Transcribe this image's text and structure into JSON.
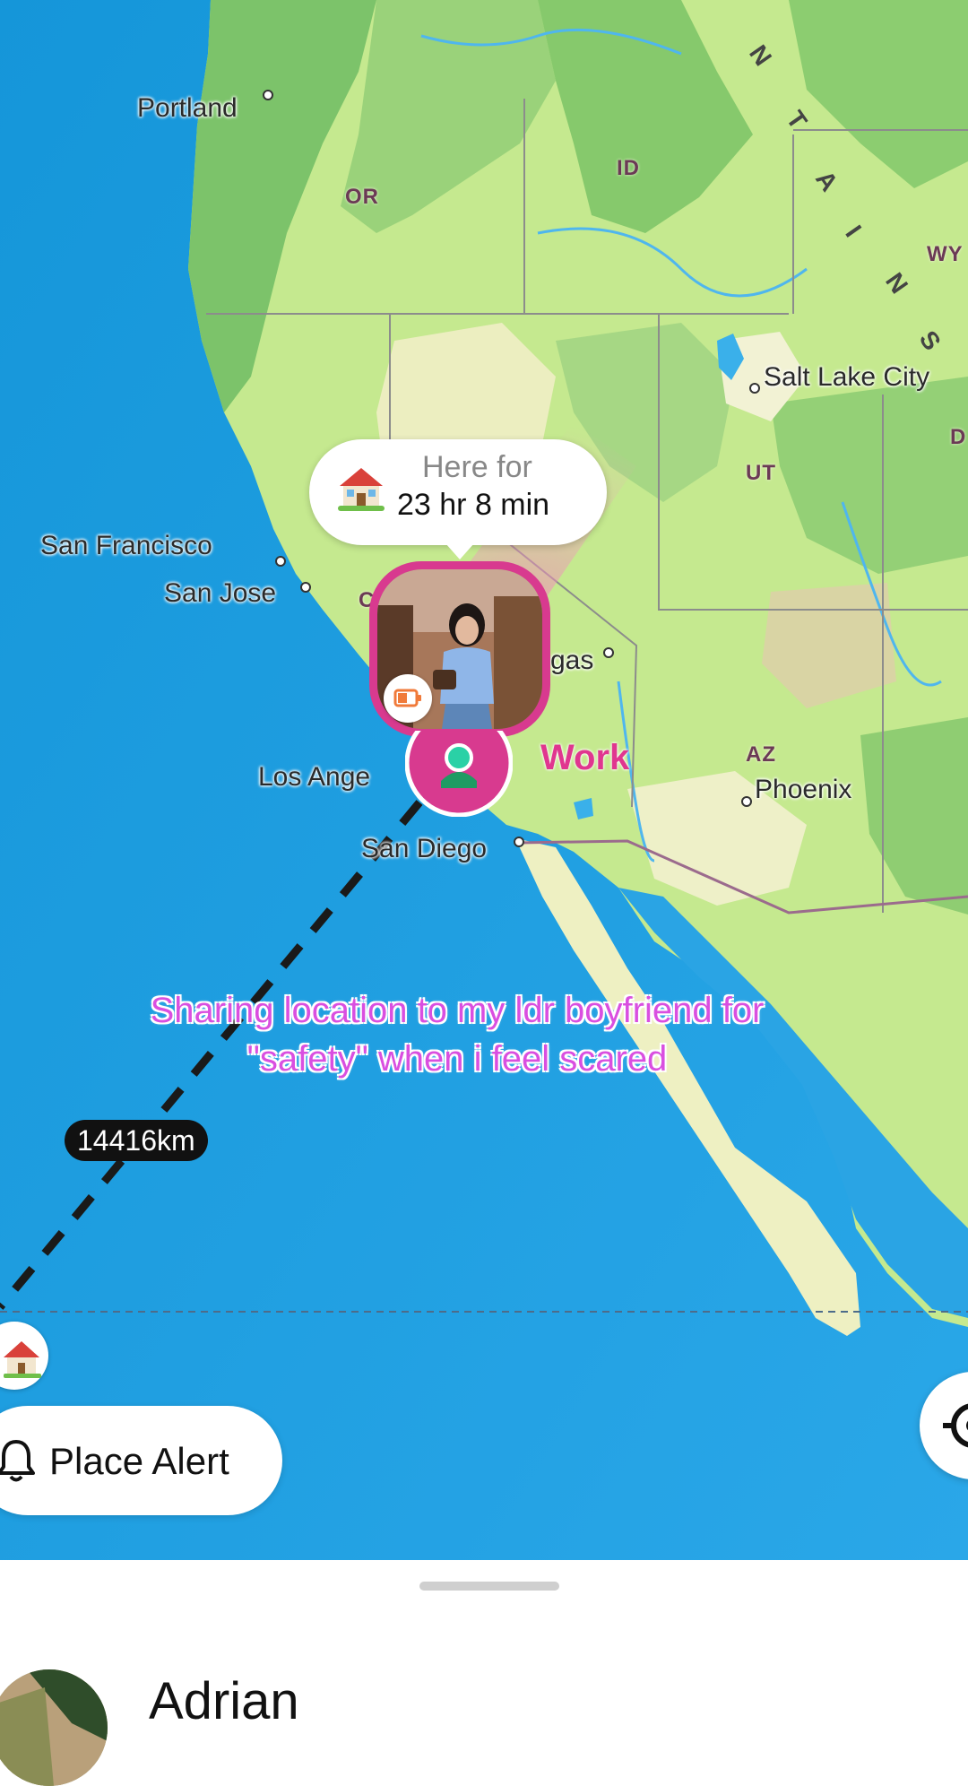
{
  "map": {
    "cities": [
      {
        "name": "Portland"
      },
      {
        "name": "San Francisco"
      },
      {
        "name": "San Jose"
      },
      {
        "name": "Los Ange"
      },
      {
        "name": "San Diego"
      },
      {
        "name": "gas"
      },
      {
        "name": "Salt Lake City"
      },
      {
        "name": "Phoenix"
      }
    ],
    "states": [
      "OR",
      "ID",
      "UT",
      "AZ",
      "WY",
      "C",
      "D"
    ],
    "range_letters": [
      "N",
      "T",
      "A",
      "I",
      "N",
      "S"
    ],
    "colors": {
      "ocean": "#1e9ae0",
      "land": "#c9ec94",
      "pin": "#d83a8f",
      "caption": "#d94fe0"
    }
  },
  "status_popup": {
    "icon": "house-icon",
    "label": "Here for",
    "duration": "23 hr 8 min"
  },
  "friend_marker": {
    "place_label": "Work",
    "battery_icon": "battery-low-icon"
  },
  "distance_badge": "14416km",
  "caption": {
    "line1": "Sharing location to my ldr boyfriend for",
    "line2": "\"safety\" when i feel scared"
  },
  "controls": {
    "place_alert_label": "Place Alert",
    "bell_icon": "bell-icon",
    "locate_icon": "crosshair-icon"
  },
  "sheet": {
    "friend_name": "Adrian"
  }
}
